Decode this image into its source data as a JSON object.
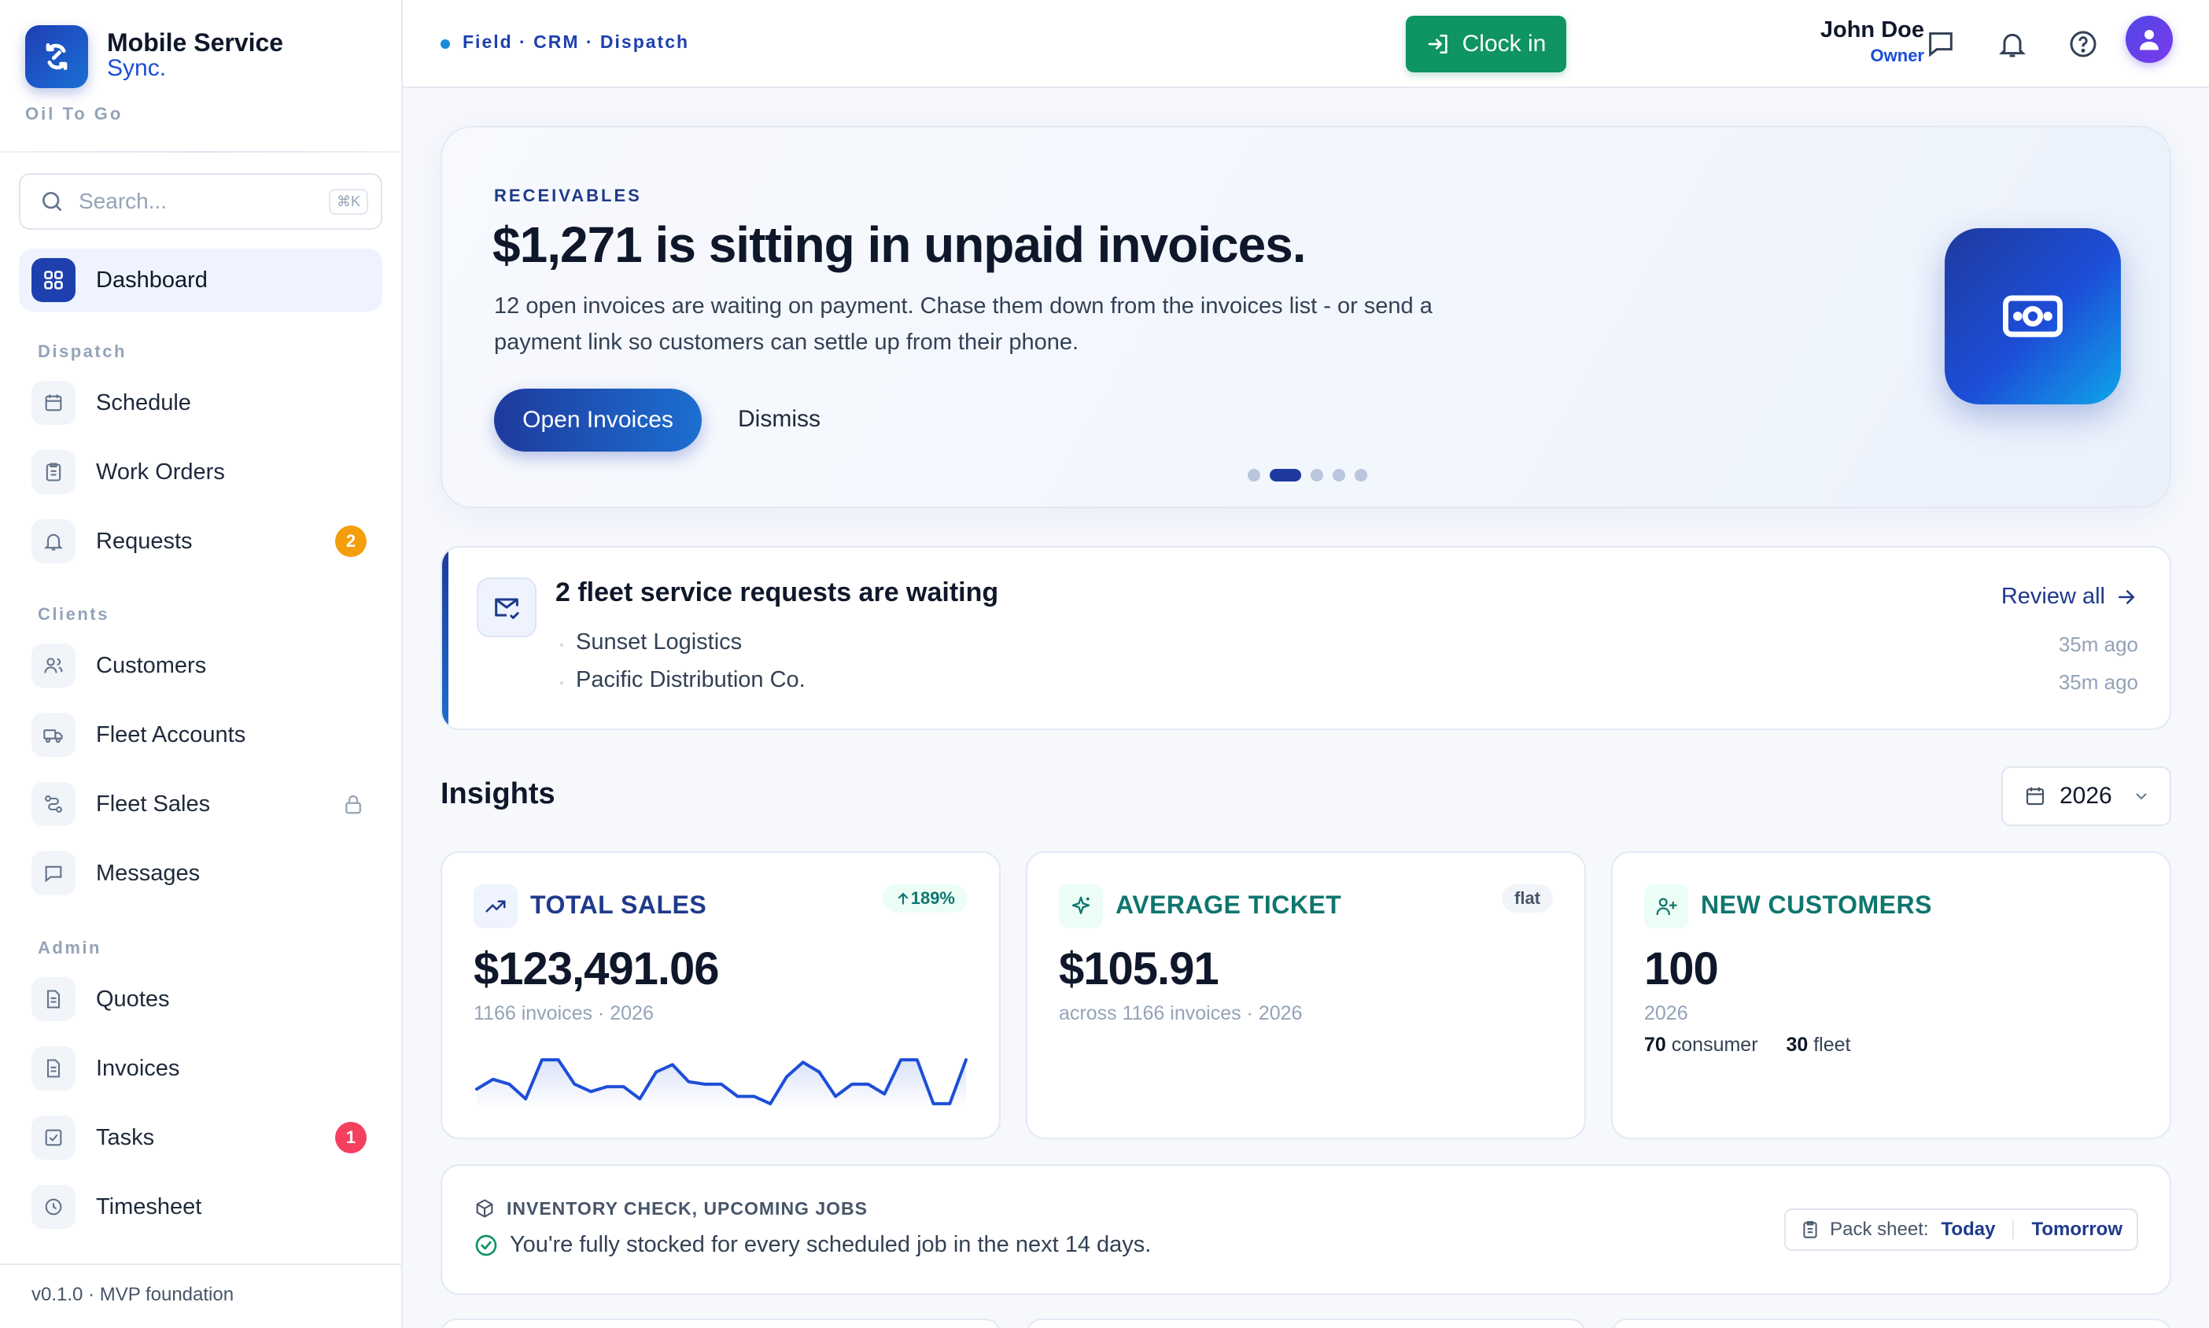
{
  "brand": {
    "title": "Mobile Service",
    "subtitle": "Sync.",
    "org": "Oil To Go"
  },
  "search": {
    "placeholder": "Search...",
    "shortcut": "⌘K"
  },
  "sidebar": {
    "dashboard": "Dashboard",
    "sections": {
      "dispatch": "Dispatch",
      "clients": "Clients",
      "admin": "Admin"
    },
    "items": [
      {
        "label": "Schedule",
        "icon": "calendar-icon"
      },
      {
        "label": "Work Orders",
        "icon": "clipboard-icon"
      },
      {
        "label": "Requests",
        "icon": "bell-icon",
        "badge": "2",
        "badge_color": "#f59e0b"
      },
      {
        "label": "Customers",
        "icon": "users-icon"
      },
      {
        "label": "Fleet Accounts",
        "icon": "truck-icon"
      },
      {
        "label": "Fleet Sales",
        "icon": "route-icon",
        "locked": true
      },
      {
        "label": "Messages",
        "icon": "message-icon"
      },
      {
        "label": "Quotes",
        "icon": "document-icon"
      },
      {
        "label": "Invoices",
        "icon": "document-icon"
      },
      {
        "label": "Tasks",
        "icon": "checkbox-icon",
        "badge": "1",
        "badge_color": "#f43f5e"
      },
      {
        "label": "Timesheet",
        "icon": "clock-icon"
      }
    ],
    "version": "v0.1.0 · MVP foundation"
  },
  "topbar": {
    "breadcrumb": "Field · CRM · Dispatch",
    "clock_in": "Clock in",
    "user_name": "John Doe",
    "user_role": "Owner"
  },
  "hero": {
    "kicker": "RECEIVABLES",
    "title": "$1,271 is sitting in unpaid invoices.",
    "description": "12 open invoices are waiting on payment. Chase them down from the invoices list - or send a payment link so customers can settle up from their phone.",
    "primary": "Open Invoices",
    "secondary": "Dismiss",
    "slides": 5,
    "active_slide": 2
  },
  "fleet": {
    "title": "2 fleet service requests are waiting",
    "review": "Review all",
    "requests": [
      {
        "name": "Sunset Logistics",
        "time": "35m ago"
      },
      {
        "name": "Pacific Distribution Co.",
        "time": "35m ago"
      }
    ]
  },
  "insights": {
    "title": "Insights",
    "year": "2026",
    "cards": {
      "sales": {
        "title": "TOTAL SALES",
        "pill": "189%",
        "value": "$123,491.06",
        "sub": "1166 invoices · 2026",
        "trend": [
          0.35,
          0.55,
          0.45,
          0.15,
          0.95,
          0.95,
          0.45,
          0.3,
          0.4,
          0.4,
          0.15,
          0.7,
          0.85,
          0.5,
          0.45,
          0.45,
          0.2,
          0.2,
          0.05,
          0.6,
          0.9,
          0.7,
          0.2,
          0.45,
          0.45,
          0.25,
          0.95,
          0.95,
          0.05,
          0.05,
          0.95
        ]
      },
      "ticket": {
        "title": "AVERAGE TICKET",
        "pill": "flat",
        "value": "$105.91",
        "sub": "across 1166 invoices · 2026"
      },
      "customers": {
        "title": "NEW CUSTOMERS",
        "value": "100",
        "sub": "2026",
        "consumer_count": "70",
        "consumer_label": "consumer",
        "fleet_count": "30",
        "fleet_label": "fleet"
      }
    }
  },
  "inventory": {
    "heading": "INVENTORY CHECK, UPCOMING JOBS",
    "message": "You're fully stocked for every scheduled job in the next 14 days.",
    "pack_label": "Pack sheet:",
    "today": "Today",
    "tomorrow": "Tomorrow"
  },
  "colors": {
    "primary": "#1e3a9e",
    "success": "#0f9463",
    "teal": "#0f766e"
  }
}
